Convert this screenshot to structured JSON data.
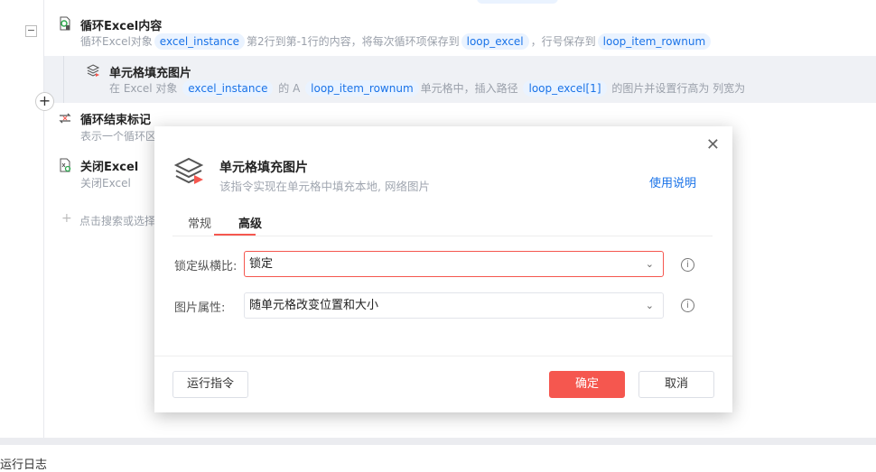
{
  "flow": {
    "items": [
      {
        "title": "循环Excel内容",
        "desc": {
          "t1": "循环Excel对象",
          "v1": "excel_instance",
          "t2": "第2行到第-1行的内容，将每次循环项保存到",
          "v2": "loop_excel",
          "t3": "，行号保存到",
          "v3": "loop_item_rownum"
        }
      },
      {
        "title": "单元格填充图片",
        "desc": {
          "t1": "在 Excel 对象",
          "v1": "excel_instance",
          "t2": "的 A",
          "v2": "loop_item_rownum",
          "t3": "单元格中，插入路径",
          "v3": "loop_excel[1]",
          "t4": "的图片并设置行高为  列宽为"
        }
      },
      {
        "title": "循环结束标记",
        "desc": "表示一个循环区"
      },
      {
        "title": "关闭Excel",
        "desc": "关闭Excel"
      }
    ],
    "add_placeholder": "点击搜索或选择",
    "collapse": "−",
    "plus": "+"
  },
  "log_label": "运行日志",
  "dialog": {
    "title": "单元格填充图片",
    "subtitle": "该指令实现在单元格中填充本地, 网络图片",
    "help": "使用说明",
    "close": "✕",
    "tabs": [
      {
        "label": "常规"
      },
      {
        "label": "高级",
        "active": true
      }
    ],
    "fields": [
      {
        "label": "锁定纵横比:",
        "value": "锁定"
      },
      {
        "label": "图片属性:",
        "value": "随单元格改变位置和大小"
      }
    ],
    "buttons": {
      "run": "运行指令",
      "ok": "确定",
      "cancel": "取消"
    }
  },
  "colors": {
    "accent": "#f5574f",
    "link": "#1a73e8",
    "highlight": "#eff1f5"
  }
}
